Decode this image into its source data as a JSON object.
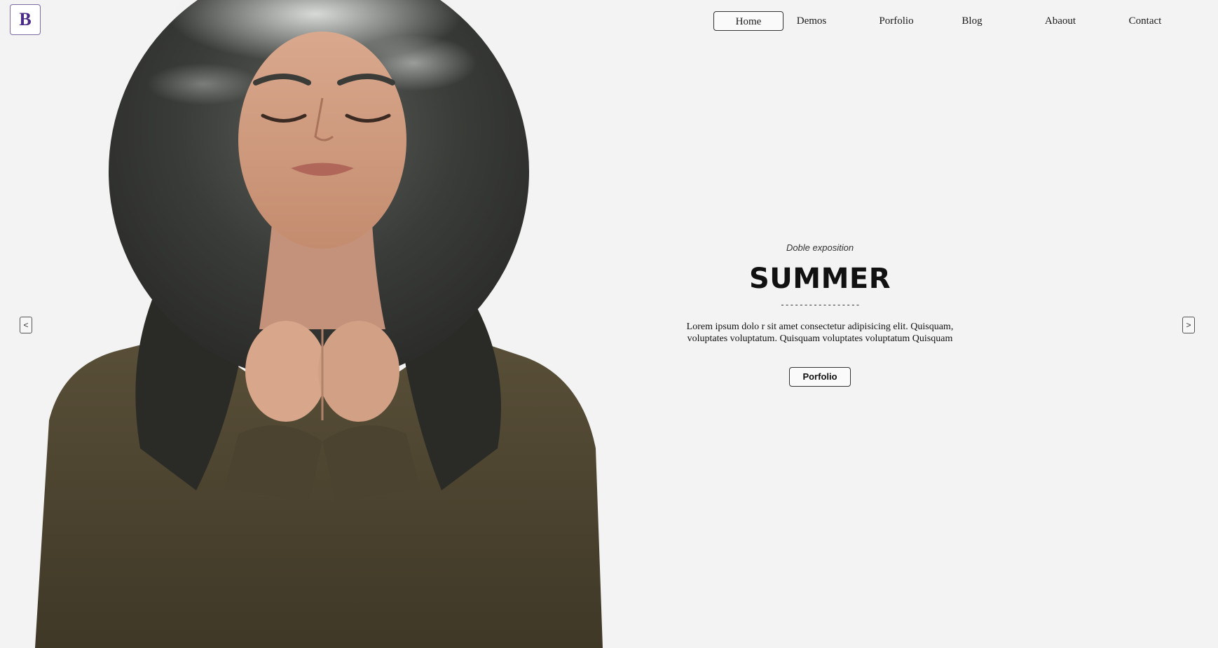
{
  "logo": {
    "letter": "B"
  },
  "nav": {
    "items": [
      {
        "label": "Home",
        "active": true
      },
      {
        "label": "Demos",
        "active": false
      },
      {
        "label": "Porfolio",
        "active": false
      },
      {
        "label": "Blog",
        "active": false
      },
      {
        "label": "Abaout",
        "active": false
      },
      {
        "label": "Contact",
        "active": false
      }
    ]
  },
  "slider": {
    "prev_label": "<",
    "next_label": ">"
  },
  "hero": {
    "kicker": "Doble exposition",
    "title": "SUMMER",
    "divider": "-----------------",
    "description_line1": "Lorem ipsum dolo r sit amet consectetur adipisicing elit. Quisquam,",
    "description_line2": "voluptates voluptatum. Quisquam voluptates voluptatum Quisquam",
    "button_label": "Porfolio"
  },
  "colors": {
    "background": "#f2f3f2",
    "logo_accent": "#4a2a88",
    "jacket": "#4e4530",
    "rock": "#3b3d3a"
  }
}
